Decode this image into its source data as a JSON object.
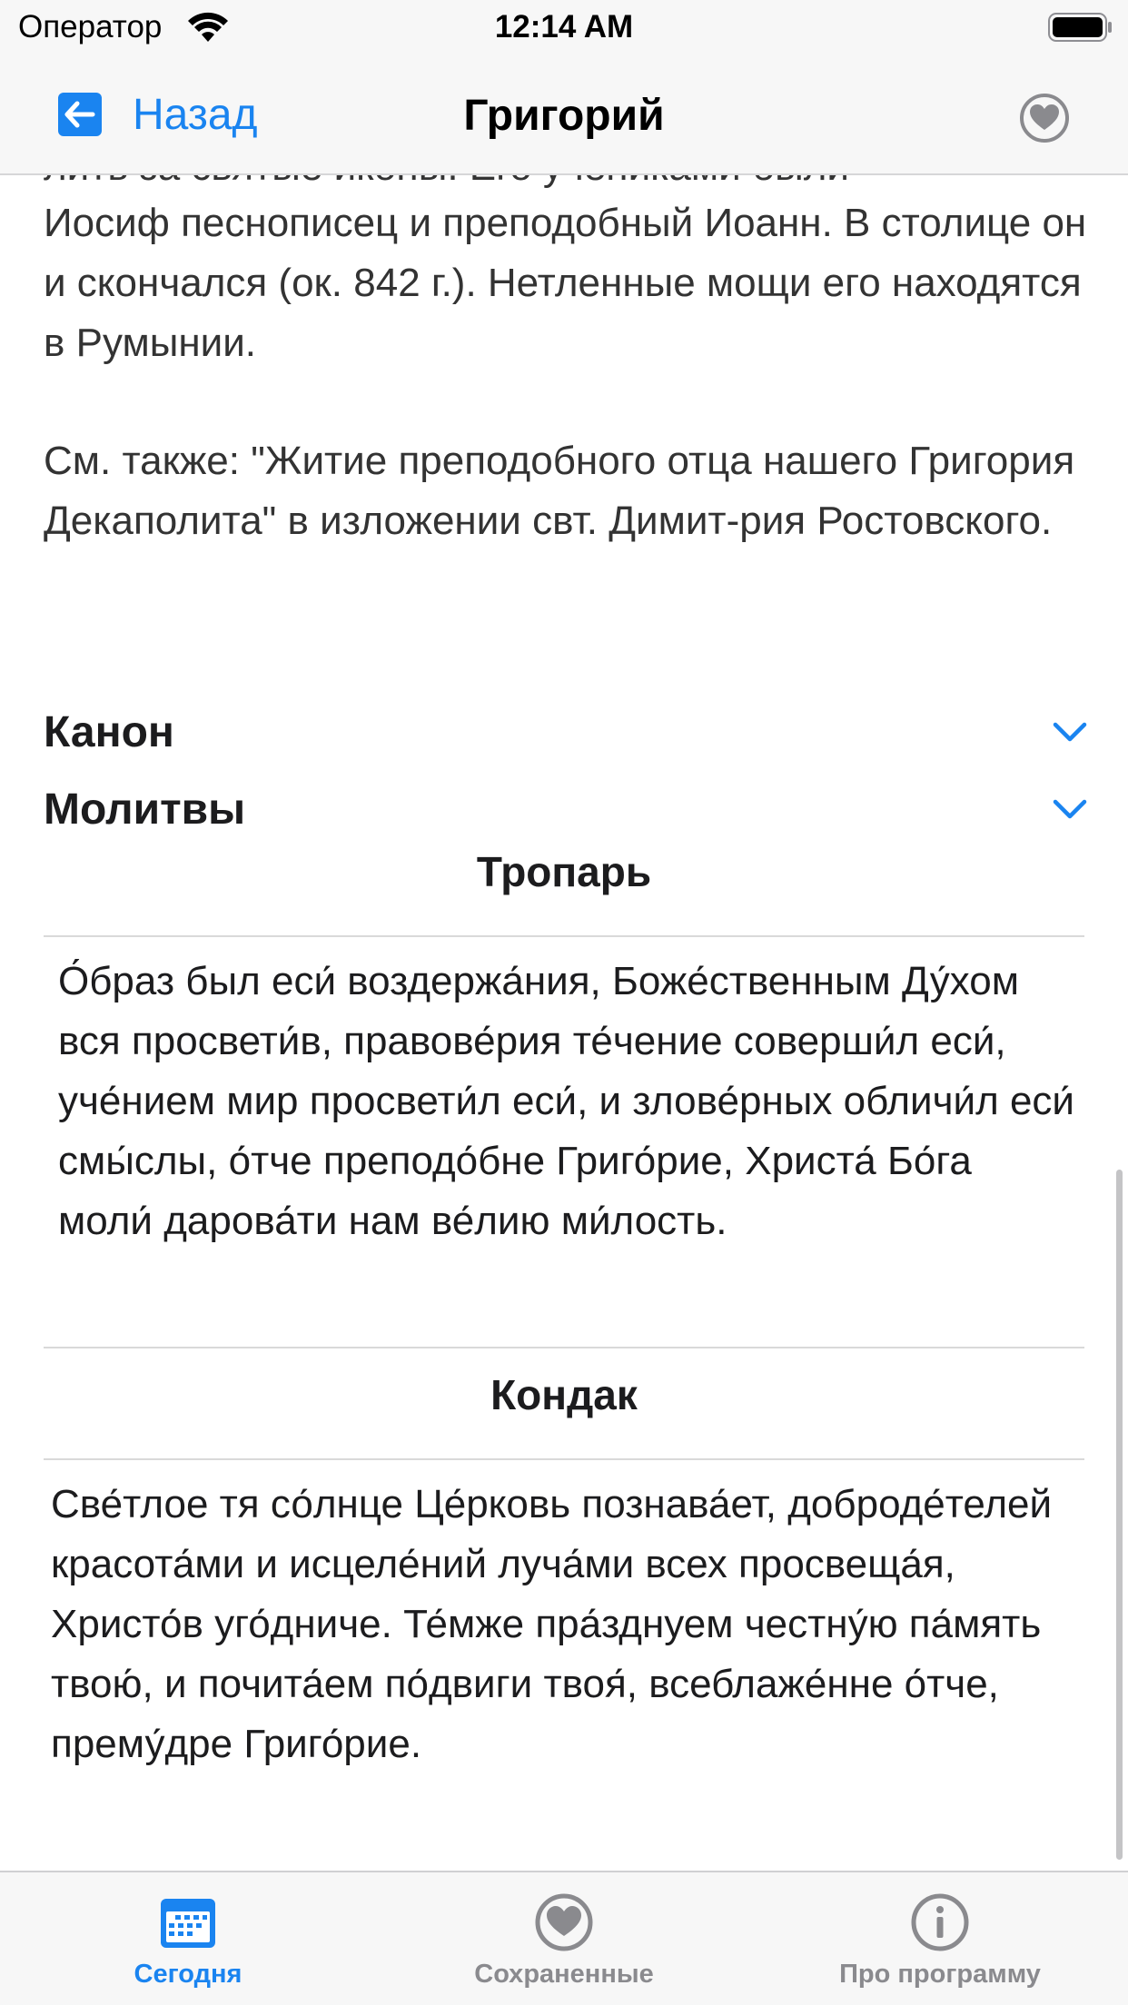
{
  "status_bar": {
    "carrier": "Оператор",
    "time": "12:14 AM"
  },
  "nav": {
    "back_label": "Назад",
    "title": "Григорий",
    "favorite_icon": "heart-circle-icon"
  },
  "content": {
    "partial_line": "лить за святые иконы. Его учениками были",
    "paragraph_1": "Иосиф песнописец и преподобный Иоанн. В столице он и скончался (ок. 842 г.). Нетленные мощи его находятся в Румынии.",
    "paragraph_2": "См. также: \"Житие преподобного отца нашего Григория Декаполита\" в изложении свт. Димит-рия Ростовского.",
    "sections": [
      {
        "label": "Канон",
        "icon": "chevron-down-icon"
      },
      {
        "label": "Молитвы",
        "icon": "chevron-down-icon"
      }
    ],
    "troparion": {
      "title": "Тропарь",
      "text": "О́браз был еси́ воздержа́ния, Боже́ственным Ду́хом вся просвети́в, правове́рия те́чение соверши́л еси́, уче́нием мир просвети́л еси́, и злове́рных обличи́л еси́ смы́слы, о́тче преподо́бне Григо́рие, Христа́ Бо́га моли́ дарова́ти нам ве́лию ми́лость."
    },
    "kontakion": {
      "title": "Кондак",
      "text": "Све́тлое тя со́лнце Це́рковь познава́ет, доброде́телей красота́ми и исцеле́ний луча́ми всех просвеща́я, Христо́в уго́дниче. Те́мже пра́зднуем честну́ю па́мять твою́, и почита́ем по́двиги твоя́, всеблаже́нне о́тче, прему́дре Григо́рие."
    }
  },
  "tabs": [
    {
      "label": "Сегодня",
      "icon": "calendar-icon",
      "active": true
    },
    {
      "label": "Сохраненные",
      "icon": "heart-circle-icon",
      "active": false
    },
    {
      "label": "Про программу",
      "icon": "info-circle-icon",
      "active": false
    }
  ],
  "colors": {
    "accent": "#1a84f0",
    "inactive": "#8a8a8e",
    "bar_background": "#f7f7f7"
  }
}
